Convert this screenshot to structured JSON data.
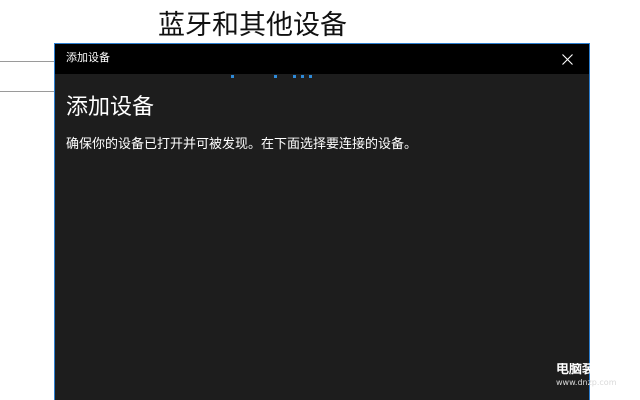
{
  "background": {
    "settings_title": "蓝牙和其他设备"
  },
  "dialog": {
    "window_title": "添加设备",
    "heading": "添加设备",
    "description": "确保你的设备已打开并可被发现。在下面选择要连接的设备。",
    "close_icon": "close-icon",
    "progress_indicator": "loading-dots",
    "accent_color": "#2d7fd0",
    "titlebar_color": "#000000",
    "body_color": "#1d1d1d"
  },
  "watermark": {
    "line1": "电脑装配网",
    "line2": "www.dnzp.com"
  }
}
